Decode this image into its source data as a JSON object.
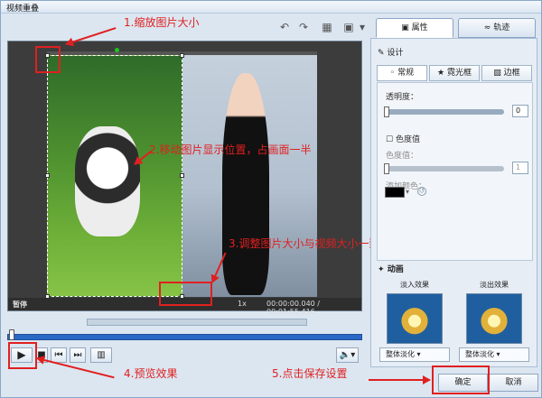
{
  "window": {
    "title": "视频重叠"
  },
  "tabs": [
    {
      "label": "属性"
    },
    {
      "label": "轨迹"
    }
  ],
  "preview": {
    "status": "暂停",
    "speed": "1x",
    "time": "00:00:00.040 / 00:01:55.416"
  },
  "annotations": [
    {
      "text": "1.缩放图片大小"
    },
    {
      "text": "2.移动图片显示位置，占画面一半"
    },
    {
      "text": "3.调整图片大小与视频大小一致"
    },
    {
      "text": "4.预览效果"
    },
    {
      "text": "5.点击保存设置"
    }
  ],
  "panel": {
    "design_title": "设计",
    "subtabs": [
      "常规",
      "霓光框",
      "边框"
    ],
    "opacity_label": "透明度：",
    "opacity_value": "0",
    "chroma_title": "色度值",
    "chroma_label": "色度值：",
    "chroma_value": "1",
    "add_color_label": "添加颜色：",
    "animation_title": "动画",
    "fade_in_label": "淡入效果",
    "fade_out_label": "淡出效果",
    "fade_in_option": "整体淡化",
    "fade_out_option": "整体淡化"
  },
  "buttons": {
    "ok": "确定",
    "cancel": "取消"
  }
}
